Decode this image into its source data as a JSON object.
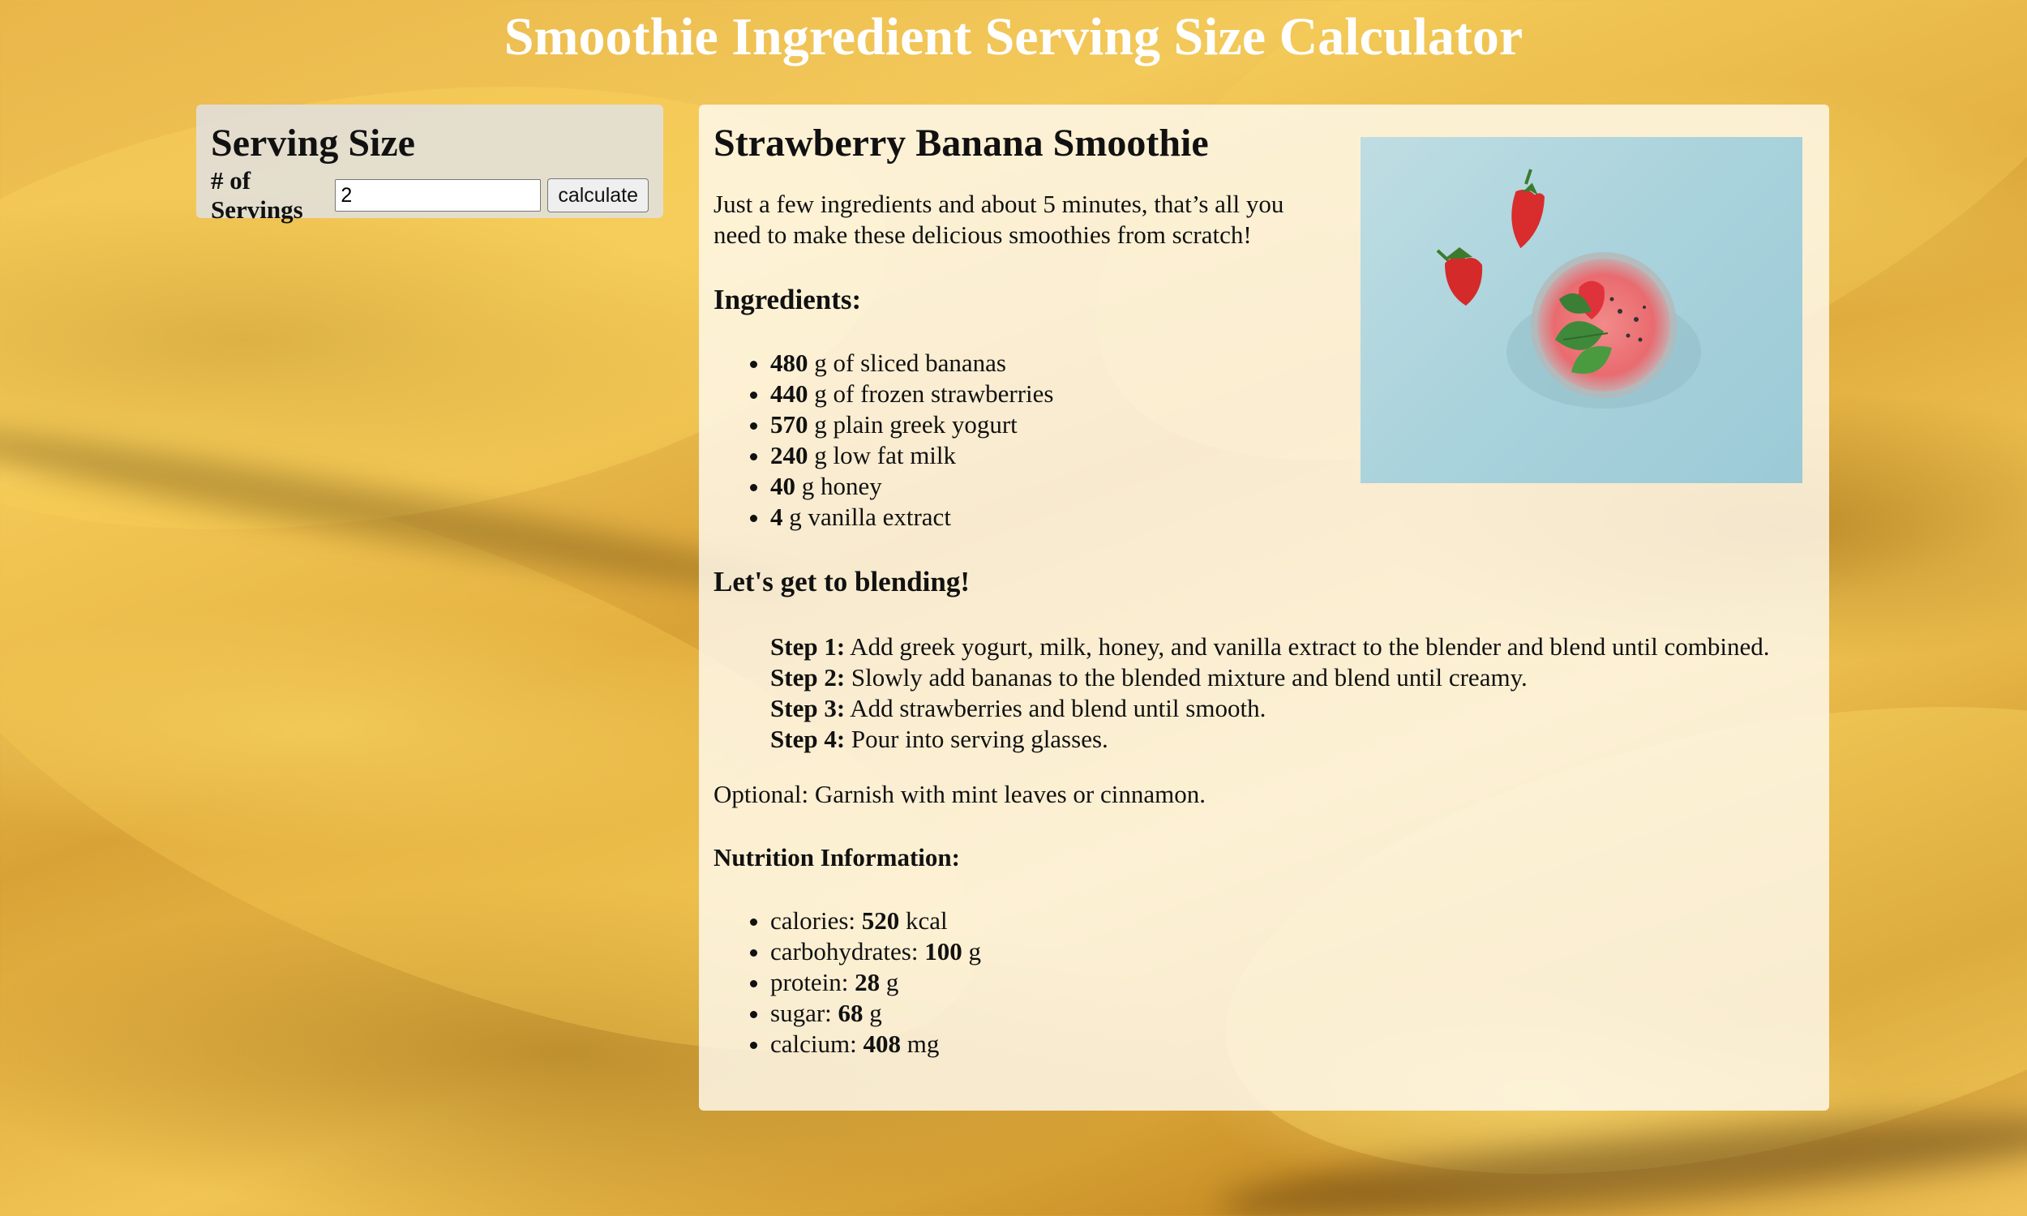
{
  "page": {
    "title": "Smoothie Ingredient Serving Size Calculator"
  },
  "serving": {
    "heading": "Serving Size",
    "servings_label": "# of Servings",
    "servings_value": "2",
    "calculate_label": "calculate"
  },
  "recipe": {
    "title": "Strawberry Banana Smoothie",
    "intro": "Just a few ingredients and about 5 minutes, that’s all you need to make these delicious smoothies from scratch!",
    "ingredients_heading": "Ingredients:",
    "ingredients": [
      {
        "amount": "480",
        "text": " g of sliced bananas"
      },
      {
        "amount": "440",
        "text": " g of frozen strawberries"
      },
      {
        "amount": "570",
        "text": " g plain greek yogurt"
      },
      {
        "amount": "240",
        "text": " g low fat milk"
      },
      {
        "amount": "40",
        "text": " g honey"
      },
      {
        "amount": "4",
        "text": " g vanilla extract"
      }
    ],
    "steps_heading": "Let's get to blending!",
    "steps": [
      {
        "label": "Step 1:",
        "text": " Add greek yogurt, milk, honey, and vanilla extract to the blender and blend until combined."
      },
      {
        "label": "Step 2:",
        "text": " Slowly add bananas to the blended mixture and blend until creamy."
      },
      {
        "label": "Step 3:",
        "text": " Add strawberries and blend until smooth."
      },
      {
        "label": "Step 4:",
        "text": " Pour into serving glasses."
      }
    ],
    "optional": "Optional: Garnish with mint leaves or cinnamon.",
    "nutrition_heading": "Nutrition Information:",
    "nutrition": [
      {
        "name": "calories: ",
        "value": "520",
        "unit": " kcal"
      },
      {
        "name": "carbohydrates: ",
        "value": "100",
        "unit": " g"
      },
      {
        "name": "protein: ",
        "value": "28",
        "unit": " g"
      },
      {
        "name": "sugar: ",
        "value": "68",
        "unit": " g"
      },
      {
        "name": "calcium: ",
        "value": "408",
        "unit": " mg"
      }
    ]
  },
  "colors": {
    "background": "#e9b64a",
    "title_text": "#ffffff",
    "image_background": "#a9d2dc"
  }
}
